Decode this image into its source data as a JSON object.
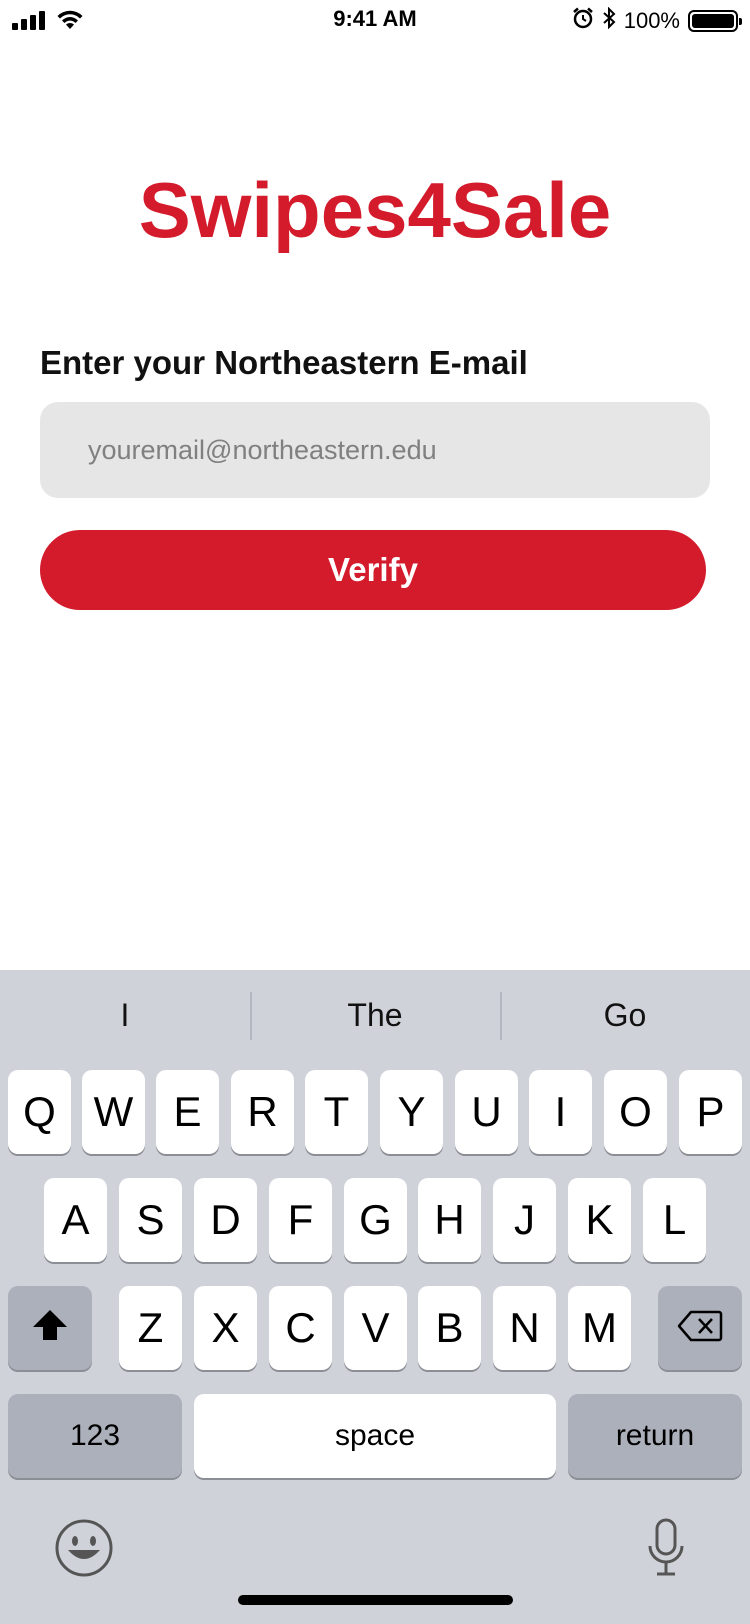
{
  "status_bar": {
    "time": "9:41 AM",
    "battery_percent": "100%",
    "icons": [
      "signal-icon",
      "wifi-icon",
      "alarm-icon",
      "bluetooth-icon",
      "battery-icon"
    ]
  },
  "app": {
    "title": "Swipes4Sale",
    "email_label": "Enter your Northeastern E-mail",
    "email_placeholder": "youremail@northeastern.edu",
    "email_value": "",
    "verify_label": "Verify",
    "accent_color": "#d41b2c"
  },
  "keyboard": {
    "suggestions": [
      "I",
      "The",
      "Go"
    ],
    "row1": [
      "Q",
      "W",
      "E",
      "R",
      "T",
      "Y",
      "U",
      "I",
      "O",
      "P"
    ],
    "row2": [
      "A",
      "S",
      "D",
      "F",
      "G",
      "H",
      "J",
      "K",
      "L"
    ],
    "row3": [
      "Z",
      "X",
      "C",
      "V",
      "B",
      "N",
      "M"
    ],
    "numbers_label": "123",
    "space_label": "space",
    "return_label": "return",
    "icons": [
      "shift-icon",
      "backspace-icon",
      "emoji-icon",
      "microphone-icon"
    ]
  }
}
